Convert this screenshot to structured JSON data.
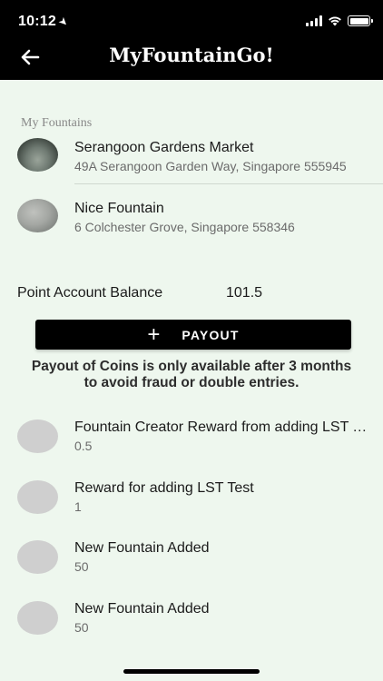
{
  "status_bar": {
    "time": "10:12"
  },
  "header": {
    "title": "MyFountainGo!"
  },
  "fountains_section": {
    "label": "My Fountains",
    "items": [
      {
        "name": "Serangoon Gardens Market",
        "address": "49A Serangoon Garden Way, Singapore 555945"
      },
      {
        "name": "Nice Fountain",
        "address": "6 Colchester Grove, Singapore 558346"
      }
    ]
  },
  "balance": {
    "label": "Point Account Balance",
    "value": "101.5"
  },
  "payout": {
    "label": "PAYOUT",
    "notice": "Payout of Coins is only available after 3 months to avoid fraud or double entries."
  },
  "transactions": [
    {
      "title": "Fountain Creator Reward from adding LST Test",
      "amount": "0.5"
    },
    {
      "title": "Reward for adding LST Test",
      "amount": "1"
    },
    {
      "title": "New Fountain Added",
      "amount": "50"
    },
    {
      "title": "New Fountain Added",
      "amount": "50"
    }
  ]
}
